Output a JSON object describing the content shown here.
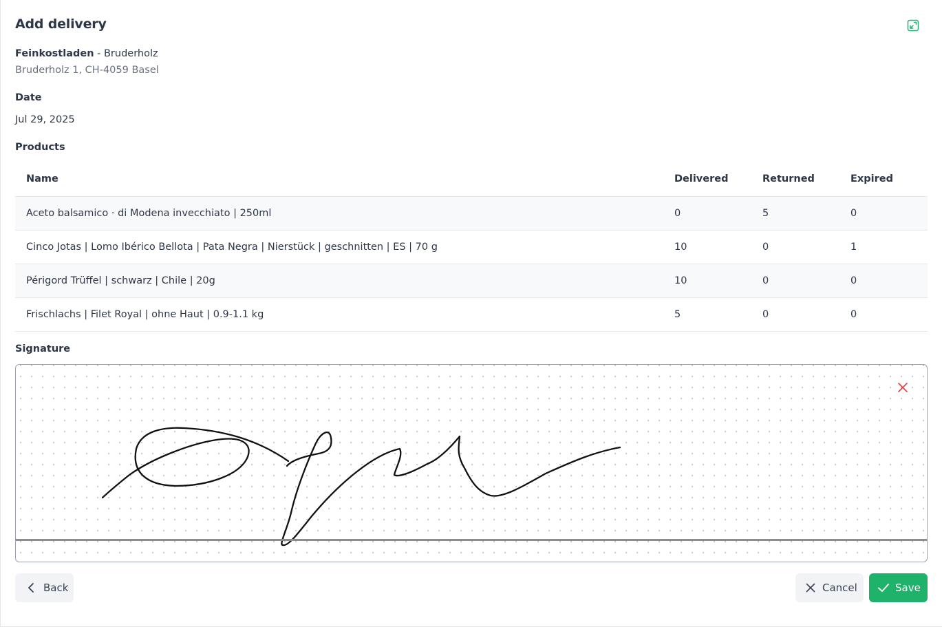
{
  "header": {
    "title": "Add delivery",
    "fullscreen_icon": "exit-fullscreen-icon",
    "accent_color": "#1eb26b"
  },
  "customer": {
    "name": "Feinkostladen",
    "separator": " - ",
    "location": "Bruderholz",
    "address": "Bruderholz 1, CH-4059 Basel"
  },
  "date": {
    "label": "Date",
    "value": "Jul 29, 2025"
  },
  "products": {
    "label": "Products",
    "columns": [
      "Name",
      "Delivered",
      "Returned",
      "Expired"
    ],
    "rows": [
      {
        "name": "Aceto balsamico · di Modena invecchiato | 250ml",
        "delivered": "0",
        "returned": "5",
        "expired": "0"
      },
      {
        "name": "Cinco Jotas | Lomo Ibérico Bellota | Pata Negra | Nierstück | geschnitten | ES | 70 g",
        "delivered": "10",
        "returned": "0",
        "expired": "1"
      },
      {
        "name": "Périgord Trüffel | schwarz | Chile | 20g",
        "delivered": "10",
        "returned": "0",
        "expired": "0"
      },
      {
        "name": "Frischlachs | Filet Royal | ohne Haut | 0.9-1.1 kg",
        "delivered": "5",
        "returned": "0",
        "expired": "0"
      }
    ]
  },
  "signature": {
    "label": "Signature",
    "clear_icon": "close-icon",
    "clear_color": "#e53e3e"
  },
  "footer": {
    "back_label": "Back",
    "back_icon": "chevron-left-icon",
    "cancel_label": "Cancel",
    "cancel_icon": "close-icon",
    "save_label": "Save",
    "save_icon": "check-icon"
  }
}
